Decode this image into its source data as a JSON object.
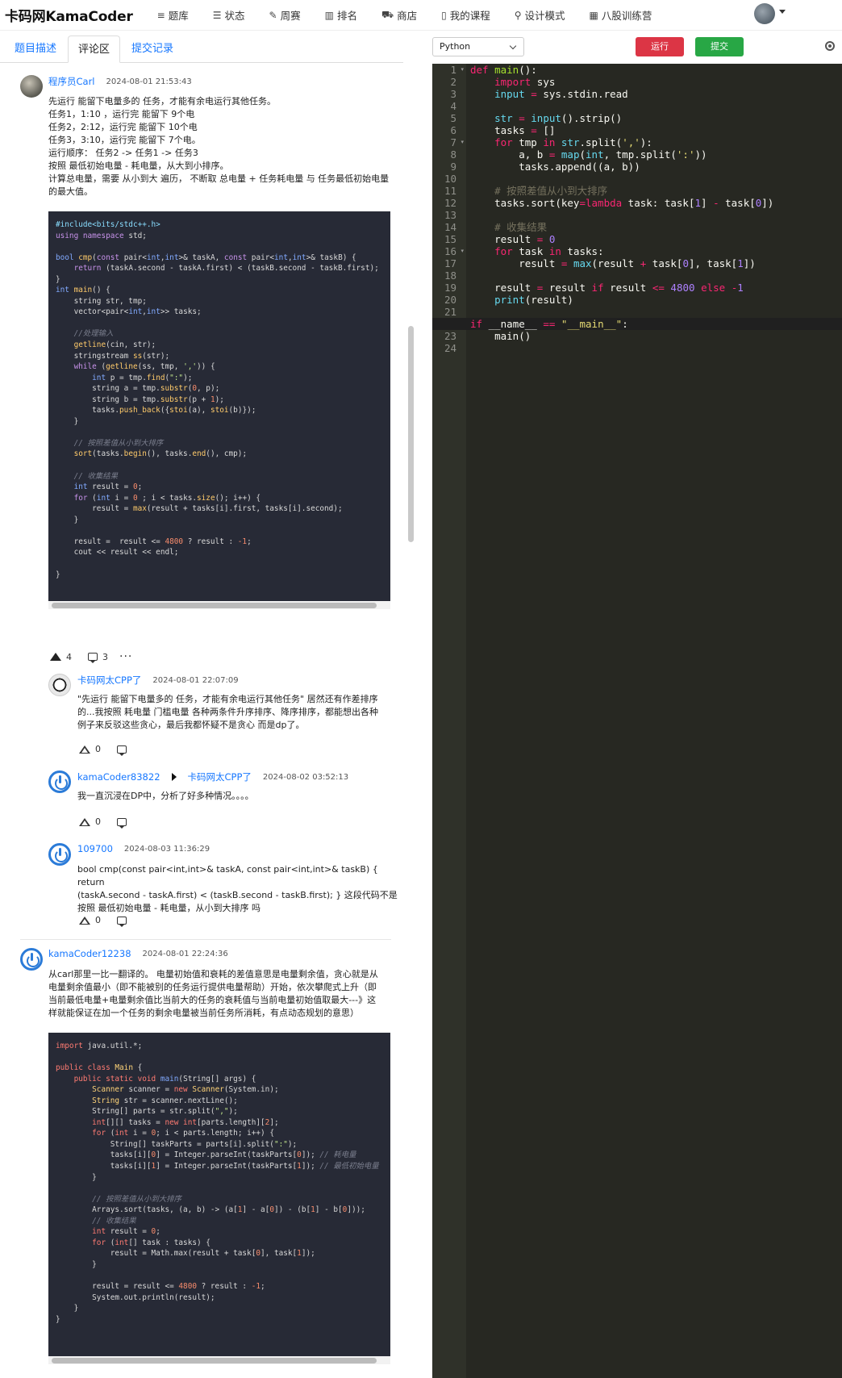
{
  "nav": {
    "brand": "卡码网KamaCoder",
    "items": [
      {
        "icon": "list-icon",
        "glyph": "≡",
        "label": "题库"
      },
      {
        "icon": "checklist-icon",
        "glyph": "☰",
        "label": "状态"
      },
      {
        "icon": "pencil-icon",
        "glyph": "✎",
        "label": "周赛"
      },
      {
        "icon": "bar-chart-icon",
        "glyph": "▥",
        "label": "排名"
      },
      {
        "icon": "cart-icon",
        "glyph": "⛟",
        "label": "商店"
      },
      {
        "icon": "book-icon",
        "glyph": "▯",
        "label": "我的课程"
      },
      {
        "icon": "sitemap-icon",
        "glyph": "⚲",
        "label": "设计模式"
      },
      {
        "icon": "calendar-icon",
        "glyph": "▦",
        "label": "八股训练营"
      }
    ]
  },
  "tabs": [
    "题目描述",
    "评论区",
    "提交记录"
  ],
  "comments": {
    "c1": {
      "user": "程序员Carl",
      "time": "2024-08-01 21:53:43",
      "lines": [
        "先运行 能留下电量多的 任务，才能有余电运行其他任务。",
        "任务1，1:10 ，运行完 能留下 9个电",
        "任务2，2:12，运行完 能留下 10个电",
        "任务3，3:10，运行完 能留下 7个电。",
        "运行顺序： 任务2 -> 任务1 -> 任务3",
        "按照 最低初始电量 - 耗电量，从大到小排序。",
        "计算总电量，需要 从小到大 遍历， 不断取 总电量 + 任务耗电量 与 任务最低初始电量",
        "的最大值。"
      ],
      "likes": "4",
      "replies": "3"
    },
    "r1": {
      "user": "卡码网太CPP了",
      "time": "2024-08-01 22:07:09",
      "lines": [
        "\"先运行 能留下电量多的 任务，才能有余电运行其他任务\" 居然还有作差排序",
        "的...我按照 耗电量 门槛电量 各种两条件升序排序、降序排序，都能想出各种",
        "例子来反驳这些贪心，最后我都怀疑不是贪心 而是dp了。"
      ],
      "likes": "0"
    },
    "r2": {
      "user": "kamaCoder83822",
      "reply_to": "卡码网太CPP了",
      "time": "2024-08-02 03:52:13",
      "lines": [
        "我一直沉浸在DP中，分析了好多种情况。。。。"
      ],
      "likes": "0"
    },
    "r3": {
      "user": "109700",
      "time": "2024-08-03 11:36:29",
      "lines": [
        "bool cmp(const pair<int,int>& taskA, const pair<int,int>& taskB) { return",
        "(taskA.second - taskA.first) < (taskB.second - taskB.first); } 这段代码不是",
        "按照 最低初始电量 - 耗电量，从小到大排序 吗"
      ],
      "likes": "0"
    },
    "c2": {
      "user": "kamaCoder12238",
      "time": "2024-08-01 22:24:36",
      "lines": [
        "从carl那里一比一翻译的。 电量初始值和衰耗的差值意思是电量剩余值，贪心就是从",
        "电量剩余值最小（即不能被别的任务运行提供电量帮助）开始，依次攀爬式上升（即",
        "当前最低电量+电量剩余值比当前大的任务的衰耗值与当前电量初始值取最大---》这",
        "样就能保证在加一个任务的剩余电量被当前任务所消耗，有点动态规划的意思）"
      ]
    }
  },
  "editor": {
    "language": "Python",
    "run_label": "运行",
    "submit_label": "提交"
  }
}
